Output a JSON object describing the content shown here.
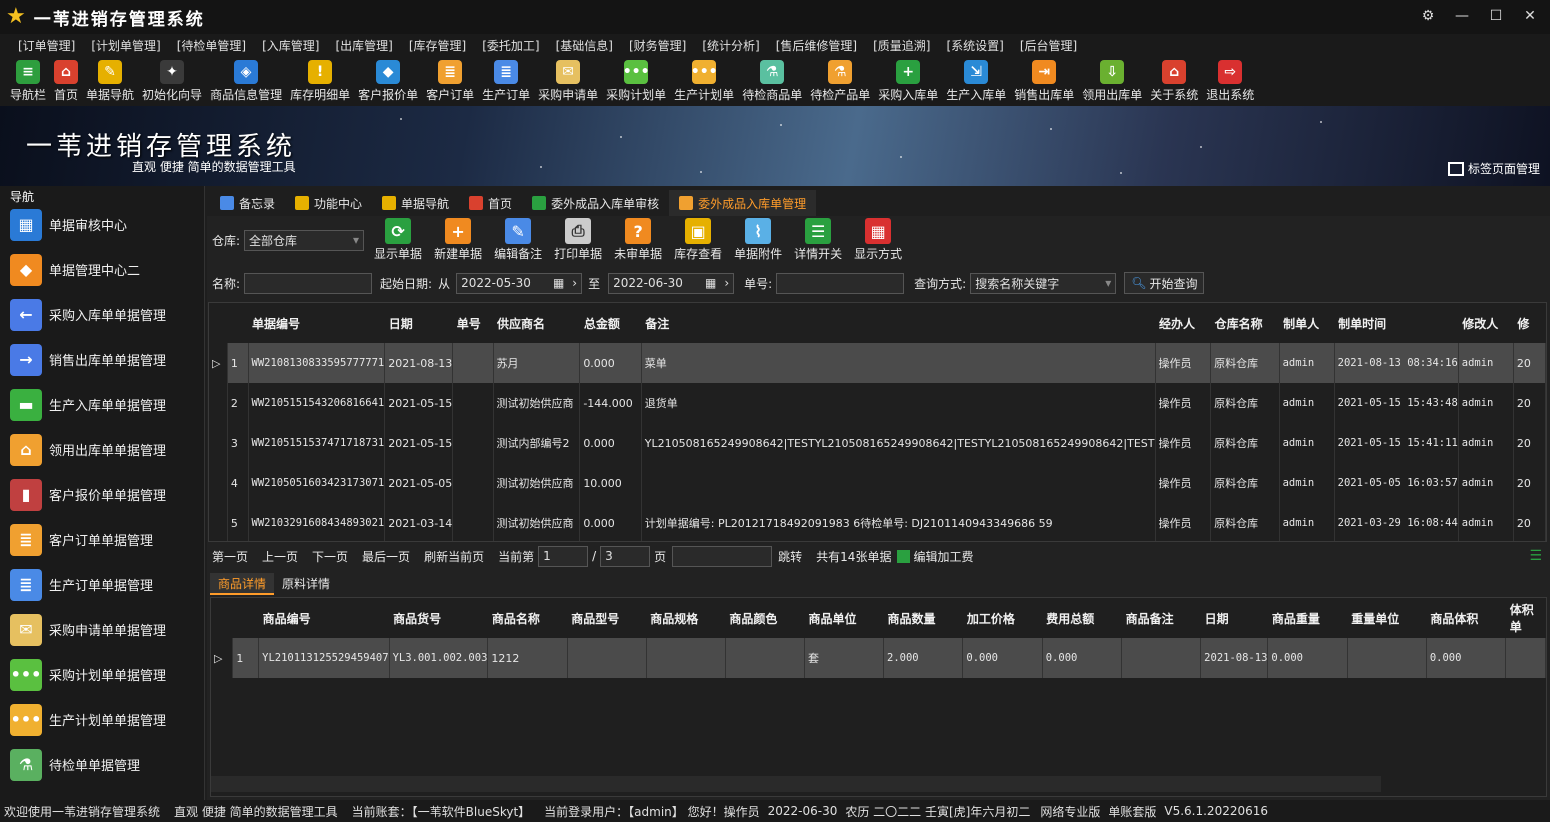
{
  "app": {
    "title": "一苇进销存管理系统"
  },
  "menu": [
    "[订单管理]",
    "[计划单管理]",
    "[待检单管理]",
    "[入库管理]",
    "[出库管理]",
    "[库存管理]",
    "[委托加工]",
    "[基础信息]",
    "[财务管理]",
    "[统计分析]",
    "[售后维修管理]",
    "[质量追溯]",
    "[系统设置]",
    "[后台管理]"
  ],
  "toolbar": [
    {
      "label": "导航栏",
      "icon": "menu-icon",
      "color": "#2e9e3e",
      "glyph": "≡"
    },
    {
      "label": "首页",
      "icon": "home-icon",
      "color": "#d9412e",
      "glyph": "⌂"
    },
    {
      "label": "单据导航",
      "icon": "nav-icon",
      "color": "#e6b000",
      "glyph": "✎"
    },
    {
      "label": "初始化向导",
      "icon": "wand-icon",
      "color": "#3a3a3a",
      "glyph": "✦"
    },
    {
      "label": "商品信息管理",
      "icon": "cubes-icon",
      "color": "#2a7ad6",
      "glyph": "◈"
    },
    {
      "label": "库存明细单",
      "icon": "warning-icon",
      "color": "#e6b000",
      "glyph": "!"
    },
    {
      "label": "客户报价单",
      "icon": "tag-icon",
      "color": "#2a8ad6",
      "glyph": "◆"
    },
    {
      "label": "客户订单",
      "icon": "order-icon",
      "color": "#f0a030",
      "glyph": "≣"
    },
    {
      "label": "生产订单",
      "icon": "production-order-icon",
      "color": "#4a8ae6",
      "glyph": "≣"
    },
    {
      "label": "采购申请单",
      "icon": "purchase-request-icon",
      "color": "#e6c060",
      "glyph": "✉"
    },
    {
      "label": "采购计划单",
      "icon": "purchase-plan-icon",
      "color": "#5ac040",
      "glyph": "•••"
    },
    {
      "label": "生产计划单",
      "icon": "production-plan-icon",
      "color": "#f0b030",
      "glyph": "•••"
    },
    {
      "label": "待检商品单",
      "icon": "pending-goods-icon",
      "color": "#5ac0a0",
      "glyph": "⚗"
    },
    {
      "label": "待检产品单",
      "icon": "flask-icon",
      "color": "#f0a030",
      "glyph": "⚗"
    },
    {
      "label": "采购入库单",
      "icon": "plus-circle-icon",
      "color": "#2aa040",
      "glyph": "+"
    },
    {
      "label": "生产入库单",
      "icon": "dolly-icon",
      "color": "#2a8ad6",
      "glyph": "⇲"
    },
    {
      "label": "销售出库单",
      "icon": "sales-out-icon",
      "color": "#f08a20",
      "glyph": "⇥"
    },
    {
      "label": "领用出库单",
      "icon": "download-icon",
      "color": "#6ab030",
      "glyph": "⇩"
    },
    {
      "label": "关于系统",
      "icon": "about-icon",
      "color": "#d9412e",
      "glyph": "⌂"
    },
    {
      "label": "退出系统",
      "icon": "exit-icon",
      "color": "#d93030",
      "glyph": "⇨"
    }
  ],
  "banner": {
    "title": "一苇进销存管理系统",
    "subtitle": "直观 便捷 简单的数据管理工具",
    "tab_manager": "标签页面管理"
  },
  "sidebar": {
    "title": "导航",
    "items": [
      {
        "label": "单据审核中心",
        "icon": "grid-icon",
        "color": "#2a7ad6",
        "glyph": "▦"
      },
      {
        "label": "单据管理中心二",
        "icon": "grid-orange-icon",
        "color": "#f08a20",
        "glyph": "◆"
      },
      {
        "label": "采购入库单单据管理",
        "icon": "arrow-left-icon",
        "color": "#4a7ae6",
        "glyph": "←"
      },
      {
        "label": "销售出库单单据管理",
        "icon": "arrow-right-icon",
        "color": "#4a7ae6",
        "glyph": "→"
      },
      {
        "label": "生产入库单单据管理",
        "icon": "folder-icon",
        "color": "#3ab040",
        "glyph": "▬"
      },
      {
        "label": "领用出库单单据管理",
        "icon": "home-doc-icon",
        "color": "#f0a030",
        "glyph": "⌂"
      },
      {
        "label": "客户报价单单据管理",
        "icon": "books-icon",
        "color": "#c04040",
        "glyph": "▮"
      },
      {
        "label": "客户订单单据管理",
        "icon": "doc-orange-icon",
        "color": "#f0a030",
        "glyph": "≣"
      },
      {
        "label": "生产订单单据管理",
        "icon": "doc-blue-icon",
        "color": "#4a8ae6",
        "glyph": "≣"
      },
      {
        "label": "采购申请单单据管理",
        "icon": "envelope-icon",
        "color": "#e6c060",
        "glyph": "✉"
      },
      {
        "label": "采购计划单单据管理",
        "icon": "chat-green-icon",
        "color": "#5ac040",
        "glyph": "•••"
      },
      {
        "label": "生产计划单单据管理",
        "icon": "chat-orange-icon",
        "color": "#f0b030",
        "glyph": "•••"
      },
      {
        "label": "待检单单据管理",
        "icon": "lab-icon",
        "color": "#5ab060",
        "glyph": "⚗"
      }
    ]
  },
  "tabs": [
    {
      "label": "备忘录",
      "icon": "memo-icon",
      "color": "#4a8ae6"
    },
    {
      "label": "功能中心",
      "icon": "function-icon",
      "color": "#e6b000"
    },
    {
      "label": "单据导航",
      "icon": "nav-tab-icon",
      "color": "#e6b000"
    },
    {
      "label": "首页",
      "icon": "home-tab-icon",
      "color": "#d9412e"
    },
    {
      "label": "委外成品入库单审核",
      "icon": "check-icon",
      "color": "#2aa040"
    },
    {
      "label": "委外成品入库单管理",
      "icon": "outsource-icon",
      "color": "#f0a030"
    }
  ],
  "filters": {
    "warehouse_label": "仓库:",
    "warehouse_value": "全部仓库",
    "name_label": "名称:",
    "name_value": "",
    "start_date_label": "起始日期:",
    "from_label": "从",
    "from_date": "2022-05-30",
    "to_label": "至",
    "to_date": "2022-06-30",
    "doc_no_label": "单号:",
    "doc_no_value": "",
    "query_mode_label": "查询方式:",
    "query_mode_value": "搜索名称关键字",
    "search_button": "开始查询"
  },
  "actions": [
    {
      "label": "显示单据",
      "icon": "refresh-icon",
      "color": "#2aa040",
      "glyph": "⟳"
    },
    {
      "label": "新建单据",
      "icon": "plus-icon",
      "color": "#f08a20",
      "glyph": "+"
    },
    {
      "label": "编辑备注",
      "icon": "calendar-edit-icon",
      "color": "#4a8ae6",
      "glyph": "✎"
    },
    {
      "label": "打印单据",
      "icon": "print-icon",
      "color": "#cccccc",
      "glyph": "⎙"
    },
    {
      "label": "未审单据",
      "icon": "question-icon",
      "color": "#f08a20",
      "glyph": "?"
    },
    {
      "label": "库存查看",
      "icon": "box-icon",
      "color": "#e6b000",
      "glyph": "▣"
    },
    {
      "label": "单据附件",
      "icon": "paperclip-icon",
      "color": "#5ab0e6",
      "glyph": "⌇"
    },
    {
      "label": "详情开关",
      "icon": "list-check-icon",
      "color": "#2aa040",
      "glyph": "☰"
    },
    {
      "label": "显示方式",
      "icon": "tiles-icon",
      "color": "#d93030",
      "glyph": "▦"
    }
  ],
  "main_grid": {
    "headers": [
      "单据编号",
      "日期",
      "单号",
      "供应商名",
      "总金额",
      "备注",
      "经办人",
      "仓库名称",
      "制单人",
      "制单时间",
      "修改人",
      "修"
    ],
    "rows": [
      [
        "1",
        "WW2108130833595777771",
        "2021-08-13",
        "",
        "苏月",
        "0.000",
        "菜单",
        "操作员",
        "原料仓库",
        "admin",
        "2021-08-13 08:34:16",
        "admin",
        "20"
      ],
      [
        "2",
        "WW2105151543206816641",
        "2021-05-15",
        "",
        "测试初始供应商",
        "-144.000",
        "退货单",
        "操作员",
        "原料仓库",
        "admin",
        "2021-05-15 15:43:48",
        "admin",
        "20"
      ],
      [
        "3",
        "WW2105151537471718731",
        "2021-05-15",
        "",
        "测试内部编号2",
        "0.000",
        "YL210508165249908642|TESTYL210508165249908642|TESTYL210508165249908642|TEST",
        "操作员",
        "原料仓库",
        "admin",
        "2021-05-15 15:41:11",
        "admin",
        "20"
      ],
      [
        "4",
        "WW2105051603423173071",
        "2021-05-05",
        "",
        "测试初始供应商",
        "10.000",
        "",
        "操作员",
        "原料仓库",
        "admin",
        "2021-05-05 16:03:57",
        "admin",
        "20"
      ],
      [
        "5",
        "WW2103291608434893021",
        "2021-03-14",
        "",
        "测试初始供应商",
        "0.000",
        "计划单据编号: PL20121718492091983 6待检单号: DJ2101140943349686 59",
        "操作员",
        "原料仓库",
        "admin",
        "2021-03-29 16:08:44",
        "admin",
        "20"
      ]
    ]
  },
  "pager": {
    "first": "第一页",
    "prev": "上一页",
    "next": "下一页",
    "last": "最后一页",
    "refresh": "刷新当前页",
    "current_label": "当前第",
    "current": "1",
    "sep": "/",
    "total_pages": "3",
    "page_unit": "页",
    "jump_value": "",
    "jump": "跳转",
    "total": "共有14张单据",
    "edit_fee": "编辑加工费"
  },
  "subtabs": [
    "商品详情",
    "原料详情"
  ],
  "detail_grid": {
    "headers": [
      "商品编号",
      "商品货号",
      "商品名称",
      "商品型号",
      "商品规格",
      "商品颜色",
      "商品单位",
      "商品数量",
      "加工价格",
      "费用总额",
      "商品备注",
      "日期",
      "商品重量",
      "重量单位",
      "商品体积",
      "体积单"
    ],
    "rows": [
      [
        "1",
        "YL210113125529459407",
        "YL3.001.002.003",
        "1212",
        "",
        "",
        "",
        "套",
        "2.000",
        "0.000",
        "0.000",
        "",
        "2021-08-13",
        "0.000",
        "",
        "0.000",
        ""
      ]
    ]
  },
  "status": {
    "welcome": "欢迎使用一苇进销存管理系统",
    "slogan": "直观 便捷 简单的数据管理工具",
    "account": "当前账套：【一苇软件BlueSkyt】",
    "user": "当前登录用户：【admin】 您好！操作员",
    "date": "2022-06-30",
    "lunar": "农历 二〇二二 壬寅[虎]年六月初二",
    "edition": "网络专业版",
    "mode": "单账套版",
    "version": "V5.6.1.20220616"
  }
}
